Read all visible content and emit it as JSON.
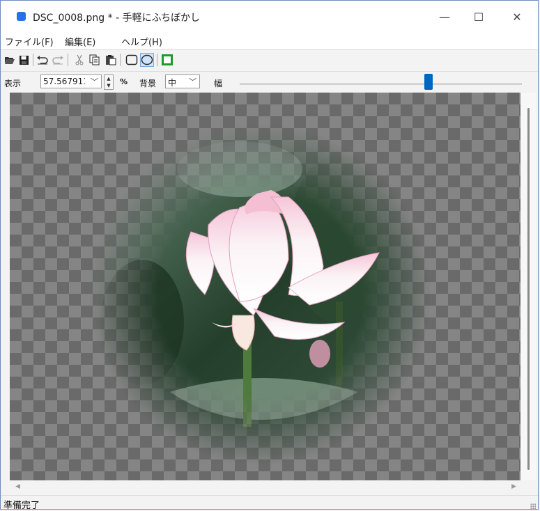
{
  "window": {
    "title": "DSC_0008.png * - 手軽にふちぼかし",
    "controls": {
      "minimize": "—",
      "maximize": "☐",
      "close": "✕"
    }
  },
  "menu": [
    {
      "label": "ファイル(F)"
    },
    {
      "label": "編集(E)"
    },
    {
      "label": "ヘルプ(H)"
    }
  ],
  "toolbar": {
    "buttons": [
      "open-folder-icon",
      "save-icon",
      "undo-icon",
      "redo-icon",
      "cut-icon",
      "copy-icon",
      "paste-icon",
      "rounded-rect-shape-icon",
      "ellipse-shape-icon",
      "green-frame-icon"
    ],
    "selected": "ellipse-shape-icon"
  },
  "options": {
    "zoom_label": "表示",
    "zoom_value": "57.567911",
    "percent": "%",
    "background_label": "背景",
    "background_value": "中",
    "width_label": "幅",
    "width_slider_position": 0.66
  },
  "status": {
    "text": "準備完了"
  },
  "colors": {
    "accent": "#0067c0",
    "frame_green": "#1b9b2a",
    "window_border": "#6d8bc0"
  }
}
